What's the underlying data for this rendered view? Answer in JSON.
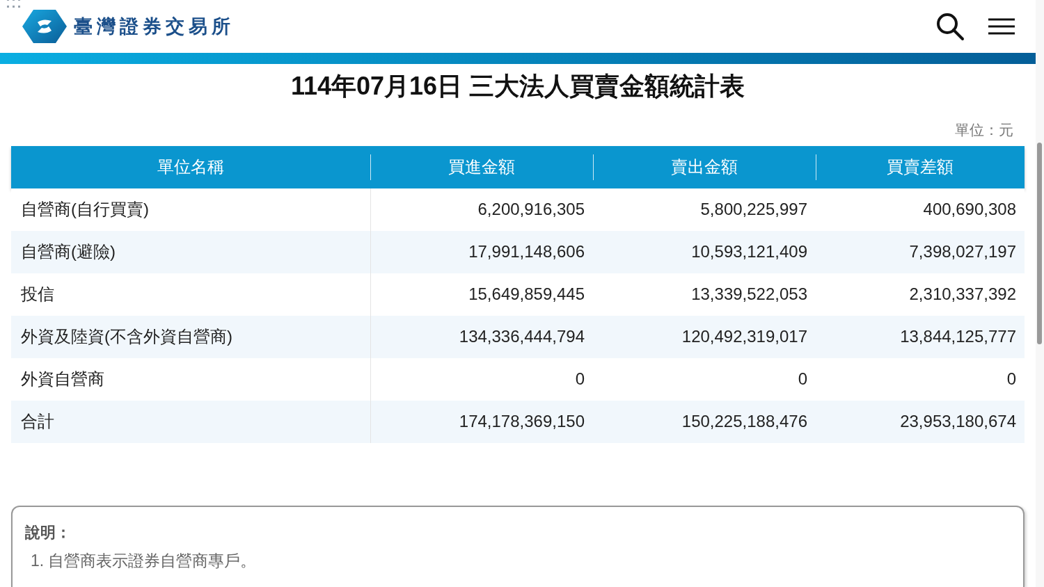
{
  "header": {
    "brand": "臺灣證券交易所"
  },
  "title": "114年07月16日 三大法人買賣金額統計表",
  "unit": "單位：元",
  "table": {
    "columns": [
      "單位名稱",
      "買進金額",
      "賣出金額",
      "買賣差額"
    ],
    "rows": [
      [
        "自營商(自行買賣)",
        "6,200,916,305",
        "5,800,225,997",
        "400,690,308"
      ],
      [
        "自營商(避險)",
        "17,991,148,606",
        "10,593,121,409",
        "7,398,027,197"
      ],
      [
        "投信",
        "15,649,859,445",
        "13,339,522,053",
        "2,310,337,392"
      ],
      [
        "外資及陸資(不含外資自營商)",
        "134,336,444,794",
        "120,492,319,017",
        "13,844,125,777"
      ],
      [
        "外資自營商",
        "0",
        "0",
        "0"
      ],
      [
        "合計",
        "174,178,369,150",
        "150,225,188,476",
        "23,953,180,674"
      ]
    ]
  },
  "notes": {
    "title": "說明：",
    "items": [
      {
        "number": "1.",
        "text": "自營商表示證券自營商專戶。"
      }
    ]
  }
}
